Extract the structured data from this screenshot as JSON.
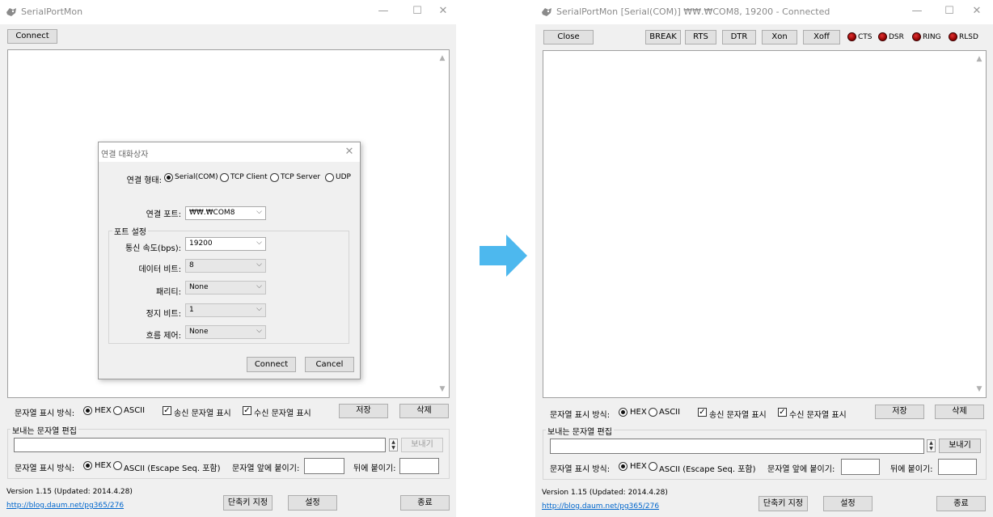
{
  "left_window": {
    "title": "SerialPortMon",
    "window_controls": {
      "minimize": "—",
      "maximize": "☐",
      "close": "✕"
    },
    "connect_button": "Connect",
    "dialog": {
      "title": "연결 대화상자",
      "close": "✕",
      "connection_type_label": "연결 형태:",
      "connection_types": [
        "Serial(COM)",
        "TCP Client",
        "TCP Server",
        "UDP"
      ],
      "selected_connection_type": "Serial(COM)",
      "port_label": "연결 포트:",
      "port_value": "₩₩.₩COM8",
      "port_settings_group": "포트 설정",
      "baud_label": "통신 속도(bps):",
      "baud_value": "19200",
      "databits_label": "데이터 비트:",
      "databits_value": "8",
      "parity_label": "패리티:",
      "parity_value": "None",
      "stopbits_label": "정지 비트:",
      "stopbits_value": "1",
      "flow_label": "흐름 제어:",
      "flow_value": "None",
      "connect_button": "Connect",
      "cancel_button": "Cancel"
    }
  },
  "right_window": {
    "title": "SerialPortMon [Serial(COM)] ₩₩.₩COM8, 19200 - Connected",
    "window_controls": {
      "minimize": "—",
      "maximize": "☐",
      "close": "✕"
    },
    "close_button": "Close",
    "signal_buttons": [
      "BREAK",
      "RTS",
      "DTR",
      "Xon",
      "Xoff"
    ],
    "indicators": [
      "CTS",
      "DSR",
      "RING",
      "RLSD"
    ],
    "indicator_color": "#b01010"
  },
  "bottom": {
    "display_mode_label": "문자열 표시 방식:",
    "hex": "HEX",
    "ascii": "ASCII",
    "show_sent": "송신 문자열 표시",
    "show_received": "수신 문자열 표시",
    "save_button": "저장",
    "delete_button": "삭제",
    "send_group": "보내는 문자열 편집",
    "send_button": "보내기",
    "send_mode_label": "문자열 표시 방식:",
    "send_hex": "HEX",
    "send_ascii": "ASCII (Escape Seq. 포함)",
    "prefix_label": "문자열 앞에 붙이기:",
    "suffix_label": "뒤에 붙이기:",
    "version": "Version 1.15 (Updated: 2014.4.28)",
    "link": "http://blog.daum.net/pg365/276",
    "shortcut_button": "단축키 지정",
    "settings_button": "설정",
    "exit_button": "종료"
  },
  "arrow_color": "#4db8ee"
}
